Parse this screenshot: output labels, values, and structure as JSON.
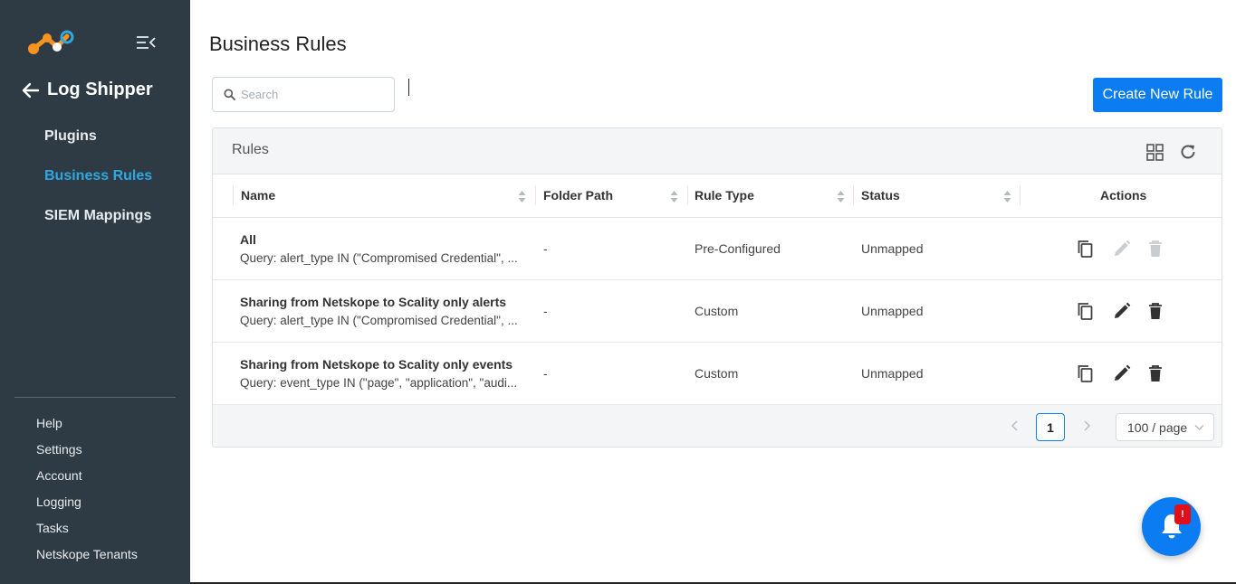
{
  "sidebar": {
    "back_title": "Log Shipper",
    "nav": [
      {
        "label": "Plugins",
        "active": false
      },
      {
        "label": "Business Rules",
        "active": true
      },
      {
        "label": "SIEM Mappings",
        "active": false
      }
    ],
    "bottom_nav": [
      {
        "label": "Help"
      },
      {
        "label": "Settings"
      },
      {
        "label": "Account"
      },
      {
        "label": "Logging"
      },
      {
        "label": "Tasks"
      },
      {
        "label": "Netskope Tenants"
      }
    ]
  },
  "page": {
    "title": "Business Rules",
    "search_placeholder": "Search",
    "create_button": "Create New Rule"
  },
  "card": {
    "title": "Rules",
    "columns": [
      "Name",
      "Folder Path",
      "Rule Type",
      "Status",
      "Actions"
    ],
    "rows": [
      {
        "name": "All",
        "query": "Query: alert_type IN (\"Compromised Credential\", ...",
        "folder": "-",
        "rule_type": "Pre-Configured",
        "status": "Unmapped",
        "editable": false
      },
      {
        "name": "Sharing from Netskope to Scality only alerts",
        "query": "Query: alert_type IN (\"Compromised Credential\", ...",
        "folder": "-",
        "rule_type": "Custom",
        "status": "Unmapped",
        "editable": true
      },
      {
        "name": "Sharing from Netskope to Scality only events",
        "query": "Query: event_type IN (\"page\", \"application\", \"audi...",
        "folder": "-",
        "rule_type": "Custom",
        "status": "Unmapped",
        "editable": true
      }
    ],
    "pagination": {
      "current_page": "1",
      "page_size": "100 / page"
    }
  },
  "notifications": {
    "badge": "!"
  },
  "colors": {
    "sidebar_bg": "#2e3a44",
    "accent": "#0b7cf2",
    "active_nav": "#2fa8e0",
    "badge": "#e0101a"
  }
}
